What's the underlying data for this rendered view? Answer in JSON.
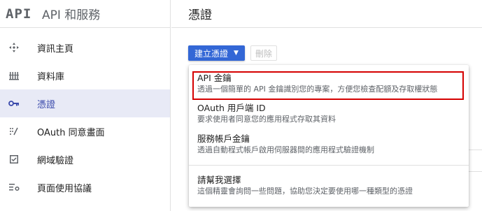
{
  "sidebar": {
    "logo": "API",
    "title": "API 和服務",
    "items": [
      {
        "label": "資訊主頁",
        "icon": "dashboard-icon"
      },
      {
        "label": "資料庫",
        "icon": "library-icon"
      },
      {
        "label": "憑證",
        "icon": "key-icon",
        "active": true
      },
      {
        "label": "OAuth 同意畫面",
        "icon": "oauth-consent-icon"
      },
      {
        "label": "網域驗證",
        "icon": "checkbox-icon"
      },
      {
        "label": "頁面使用協議",
        "icon": "settings-list-icon"
      }
    ]
  },
  "main": {
    "title": "憑證",
    "create_button": "建立憑證",
    "delete_button": "刪除"
  },
  "dropdown": {
    "items": [
      {
        "title": "API 金鑰",
        "desc": "透過一個簡單的 API 金鑰識別您的專案，方便您檢查配額及存取權狀態"
      },
      {
        "title": "OAuth 用戶端 ID",
        "desc": "要求使用者同意您的應用程式存取其資料"
      },
      {
        "title": "服務帳戶金鑰",
        "desc": "透過自動程式帳戶啟用伺服器間的應用程式驗證機制"
      },
      {
        "title": "請幫我選擇",
        "desc": "這個精靈會詢問一些問題，協助您決定要使用哪一種類型的憑證"
      }
    ]
  },
  "colors": {
    "accent": "#3367d6",
    "active_bg": "#e8eaf6",
    "highlight": "#d50000"
  }
}
